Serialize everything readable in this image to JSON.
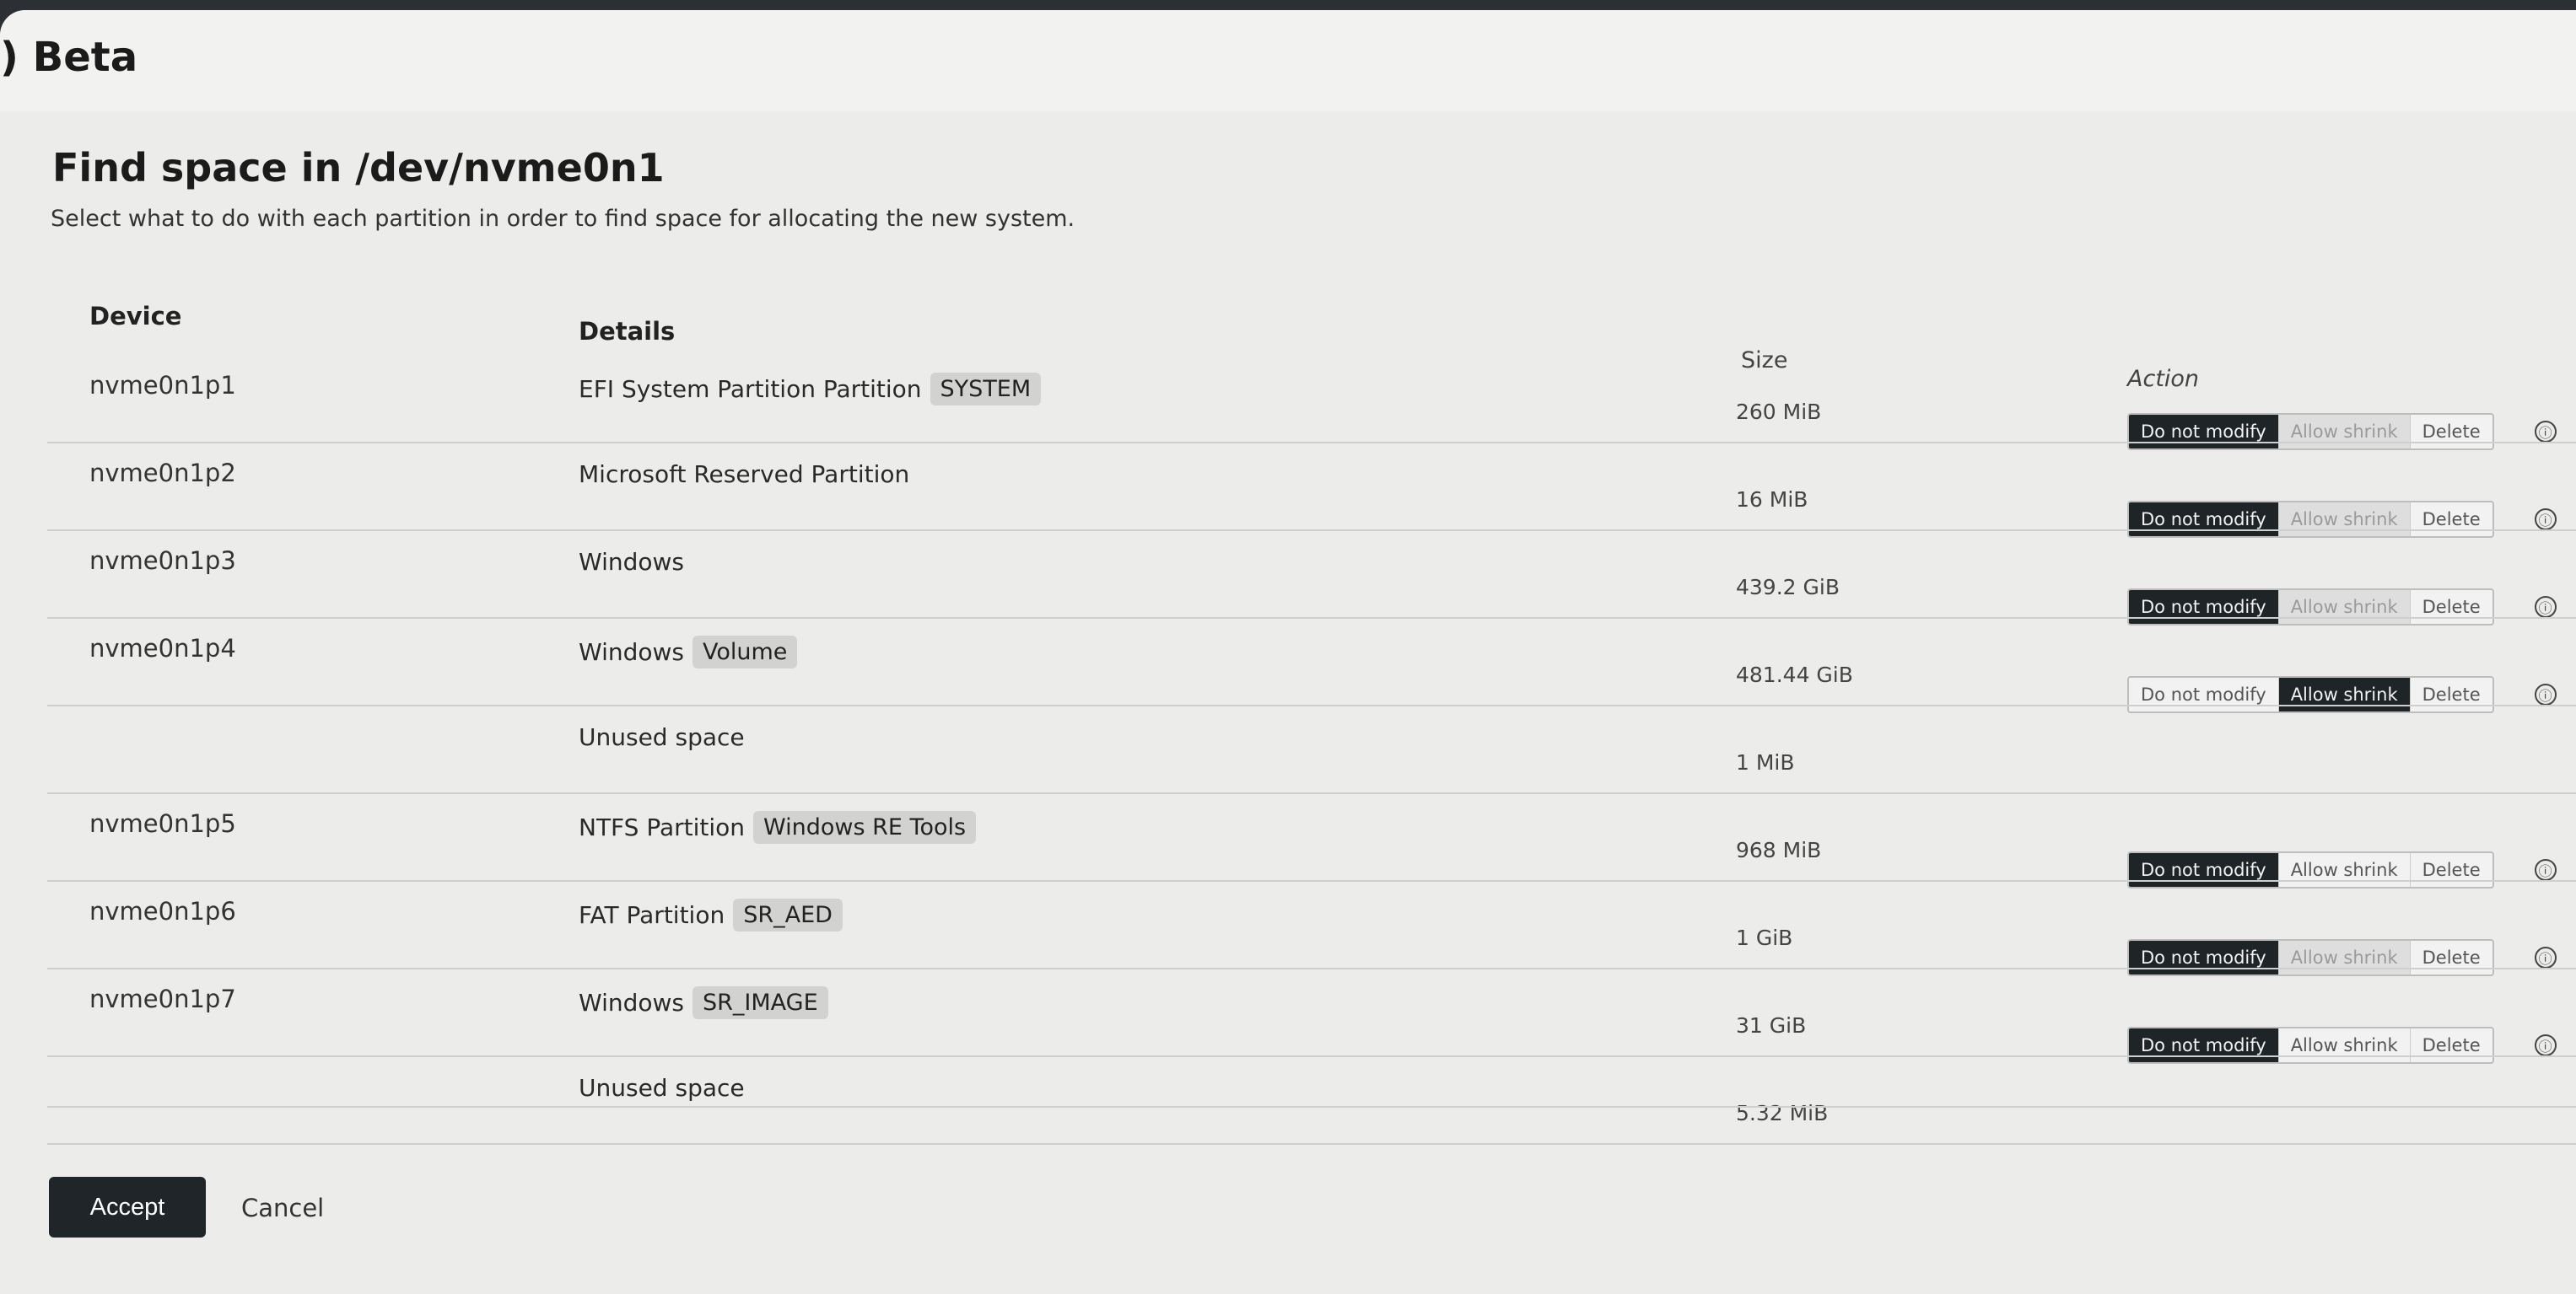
{
  "app": {
    "title": ") Beta"
  },
  "dialog": {
    "title": "Find space in /dev/nvme0n1",
    "description": "Select what to do with each partition in order to find space for allocating the new system."
  },
  "table": {
    "headers": {
      "device": "Device",
      "details": "Details",
      "size": "Size",
      "action": "Action"
    },
    "rows": [
      {
        "device": "nvme0n1p1",
        "details": "EFI System Partition Partition",
        "tag": "SYSTEM",
        "size": "260 MiB",
        "action": "Do not modify",
        "has_actions": true
      },
      {
        "device": "nvme0n1p2",
        "details": "Microsoft Reserved Partition",
        "tag": "",
        "size": "16 MiB",
        "action": "Do not modify",
        "has_actions": true
      },
      {
        "device": "nvme0n1p3",
        "details": "Windows",
        "tag": "",
        "size": "439.2 GiB",
        "action": "Do not modify",
        "has_actions": true
      },
      {
        "device": "nvme0n1p4",
        "details": "Windows",
        "tag": "Volume",
        "size": "481.44 GiB",
        "action": "Allow shrink",
        "has_actions": true
      },
      {
        "device": "",
        "details": "Unused space",
        "tag": "",
        "size": "1 MiB",
        "action": "",
        "has_actions": false
      },
      {
        "device": "nvme0n1p5",
        "details": "NTFS Partition",
        "tag": "Windows RE Tools",
        "size": "968 MiB",
        "action": "Do not modify",
        "has_actions": true
      },
      {
        "device": "nvme0n1p6",
        "details": "FAT Partition",
        "tag": "SR_AED",
        "size": "1 GiB",
        "action": "Do not modify",
        "has_actions": true
      },
      {
        "device": "nvme0n1p7",
        "details": "Windows",
        "tag": "SR_IMAGE",
        "size": "31 GiB",
        "action": "Do not modify",
        "has_actions": true
      },
      {
        "device": "",
        "details": "Unused space",
        "tag": "",
        "size": "5.32 MiB",
        "action": "",
        "has_actions": false
      }
    ],
    "action_labels": {
      "keep": "Do not modify",
      "shrink": "Allow shrink",
      "delete": "Delete"
    },
    "info_glyph": "ⓘ"
  },
  "footer": {
    "accept": "Accept",
    "cancel": "Cancel"
  }
}
